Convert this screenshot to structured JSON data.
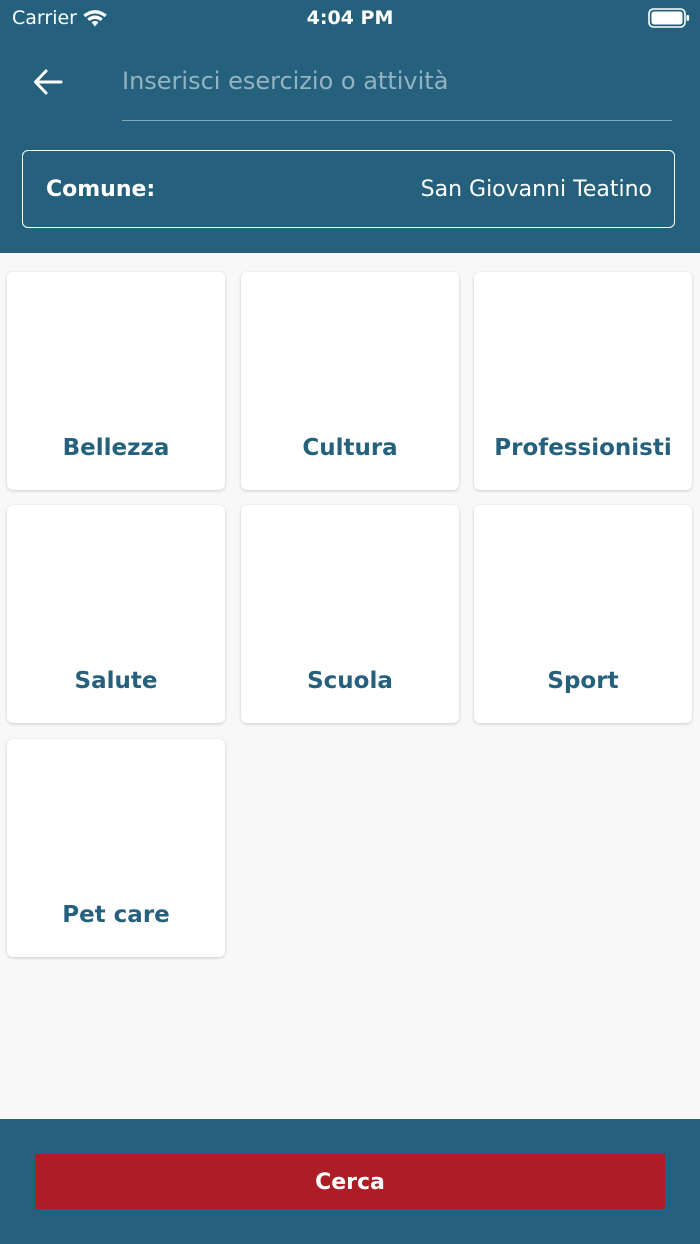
{
  "status_bar": {
    "carrier": "Carrier",
    "time": "4:04 PM",
    "wifi_icon": "wifi-icon",
    "battery_icon": "battery-full-icon"
  },
  "header": {
    "back_icon": "arrow-left-icon",
    "search": {
      "value": "",
      "placeholder": "Inserisci esercizio o attività"
    },
    "comune": {
      "label": "Comune:",
      "value": "San Giovanni Teatino"
    }
  },
  "categories": [
    {
      "label": "Bellezza"
    },
    {
      "label": "Cultura"
    },
    {
      "label": "Professionisti"
    },
    {
      "label": "Salute"
    },
    {
      "label": "Scuola"
    },
    {
      "label": "Sport"
    },
    {
      "label": "Pet care"
    }
  ],
  "footer": {
    "search_button_label": "Cerca"
  },
  "colors": {
    "primary": "#25617d",
    "button": "#ac1d25",
    "background": "#f8f8f8",
    "card": "#ffffff"
  }
}
